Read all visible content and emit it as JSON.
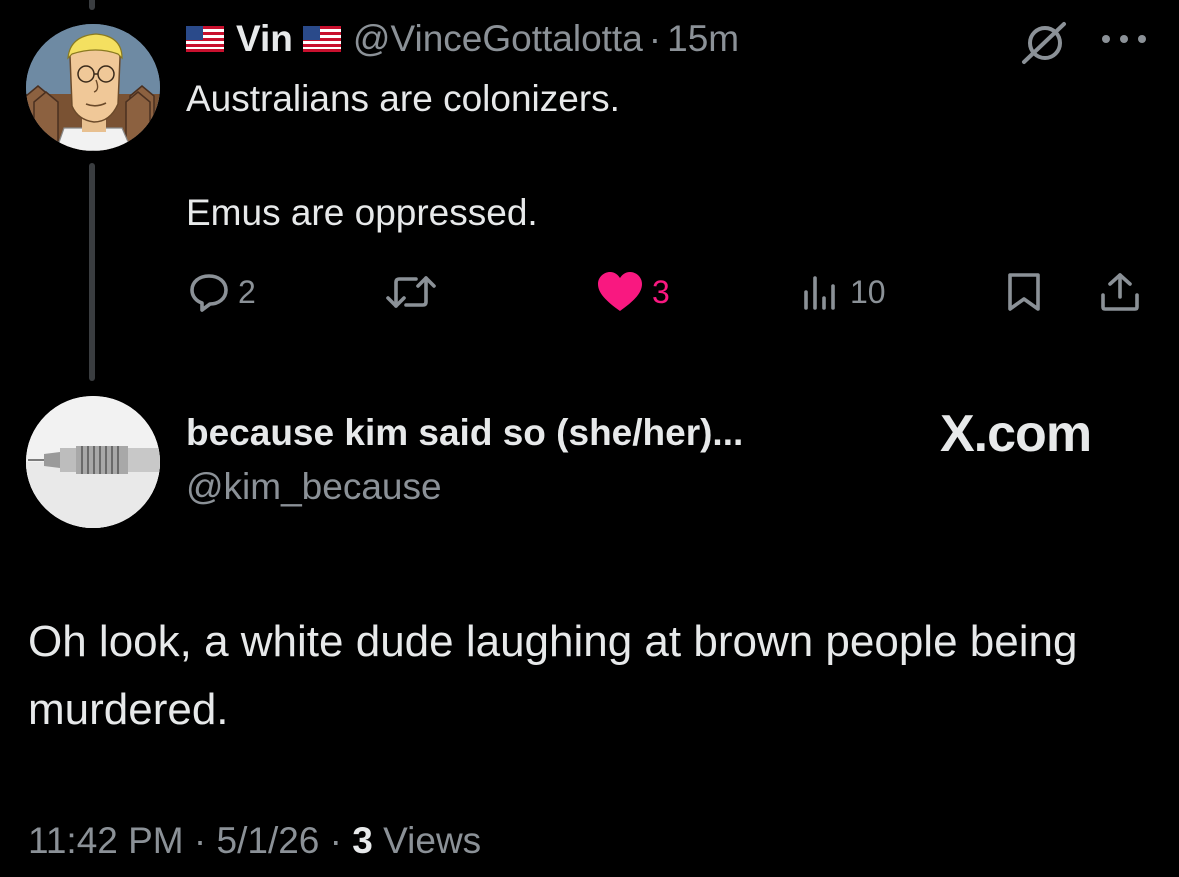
{
  "parent_tweet": {
    "display_name": "Vin",
    "handle": "@VinceGottalotta",
    "separator": "·",
    "time": "15m",
    "text_line_1": "Australians are colonizers.",
    "text_line_2": "Emus are oppressed.",
    "reply_count": "2",
    "like_count": "3",
    "view_count": "10",
    "icons": [
      "flag-us-icon",
      "grok-icon",
      "more-icon",
      "reply-icon",
      "retweet-icon",
      "like-icon",
      "views-icon",
      "bookmark-icon",
      "share-icon"
    ]
  },
  "reply_tweet": {
    "display_name": "because kim said so (she/her)...",
    "handle": "@kim_because",
    "brand": "X.com",
    "text": "Oh look, a white dude laughing at brown people being murdered.",
    "time": "11:42 PM",
    "date": "5/1/26",
    "views_count": "3",
    "views_label": "Views",
    "separator": "·"
  },
  "colors": {
    "background": "#000000",
    "text_primary": "#e7e9ea",
    "text_secondary": "#8b9197",
    "like_accent": "#f91880",
    "thread_line": "#3a3d40"
  }
}
